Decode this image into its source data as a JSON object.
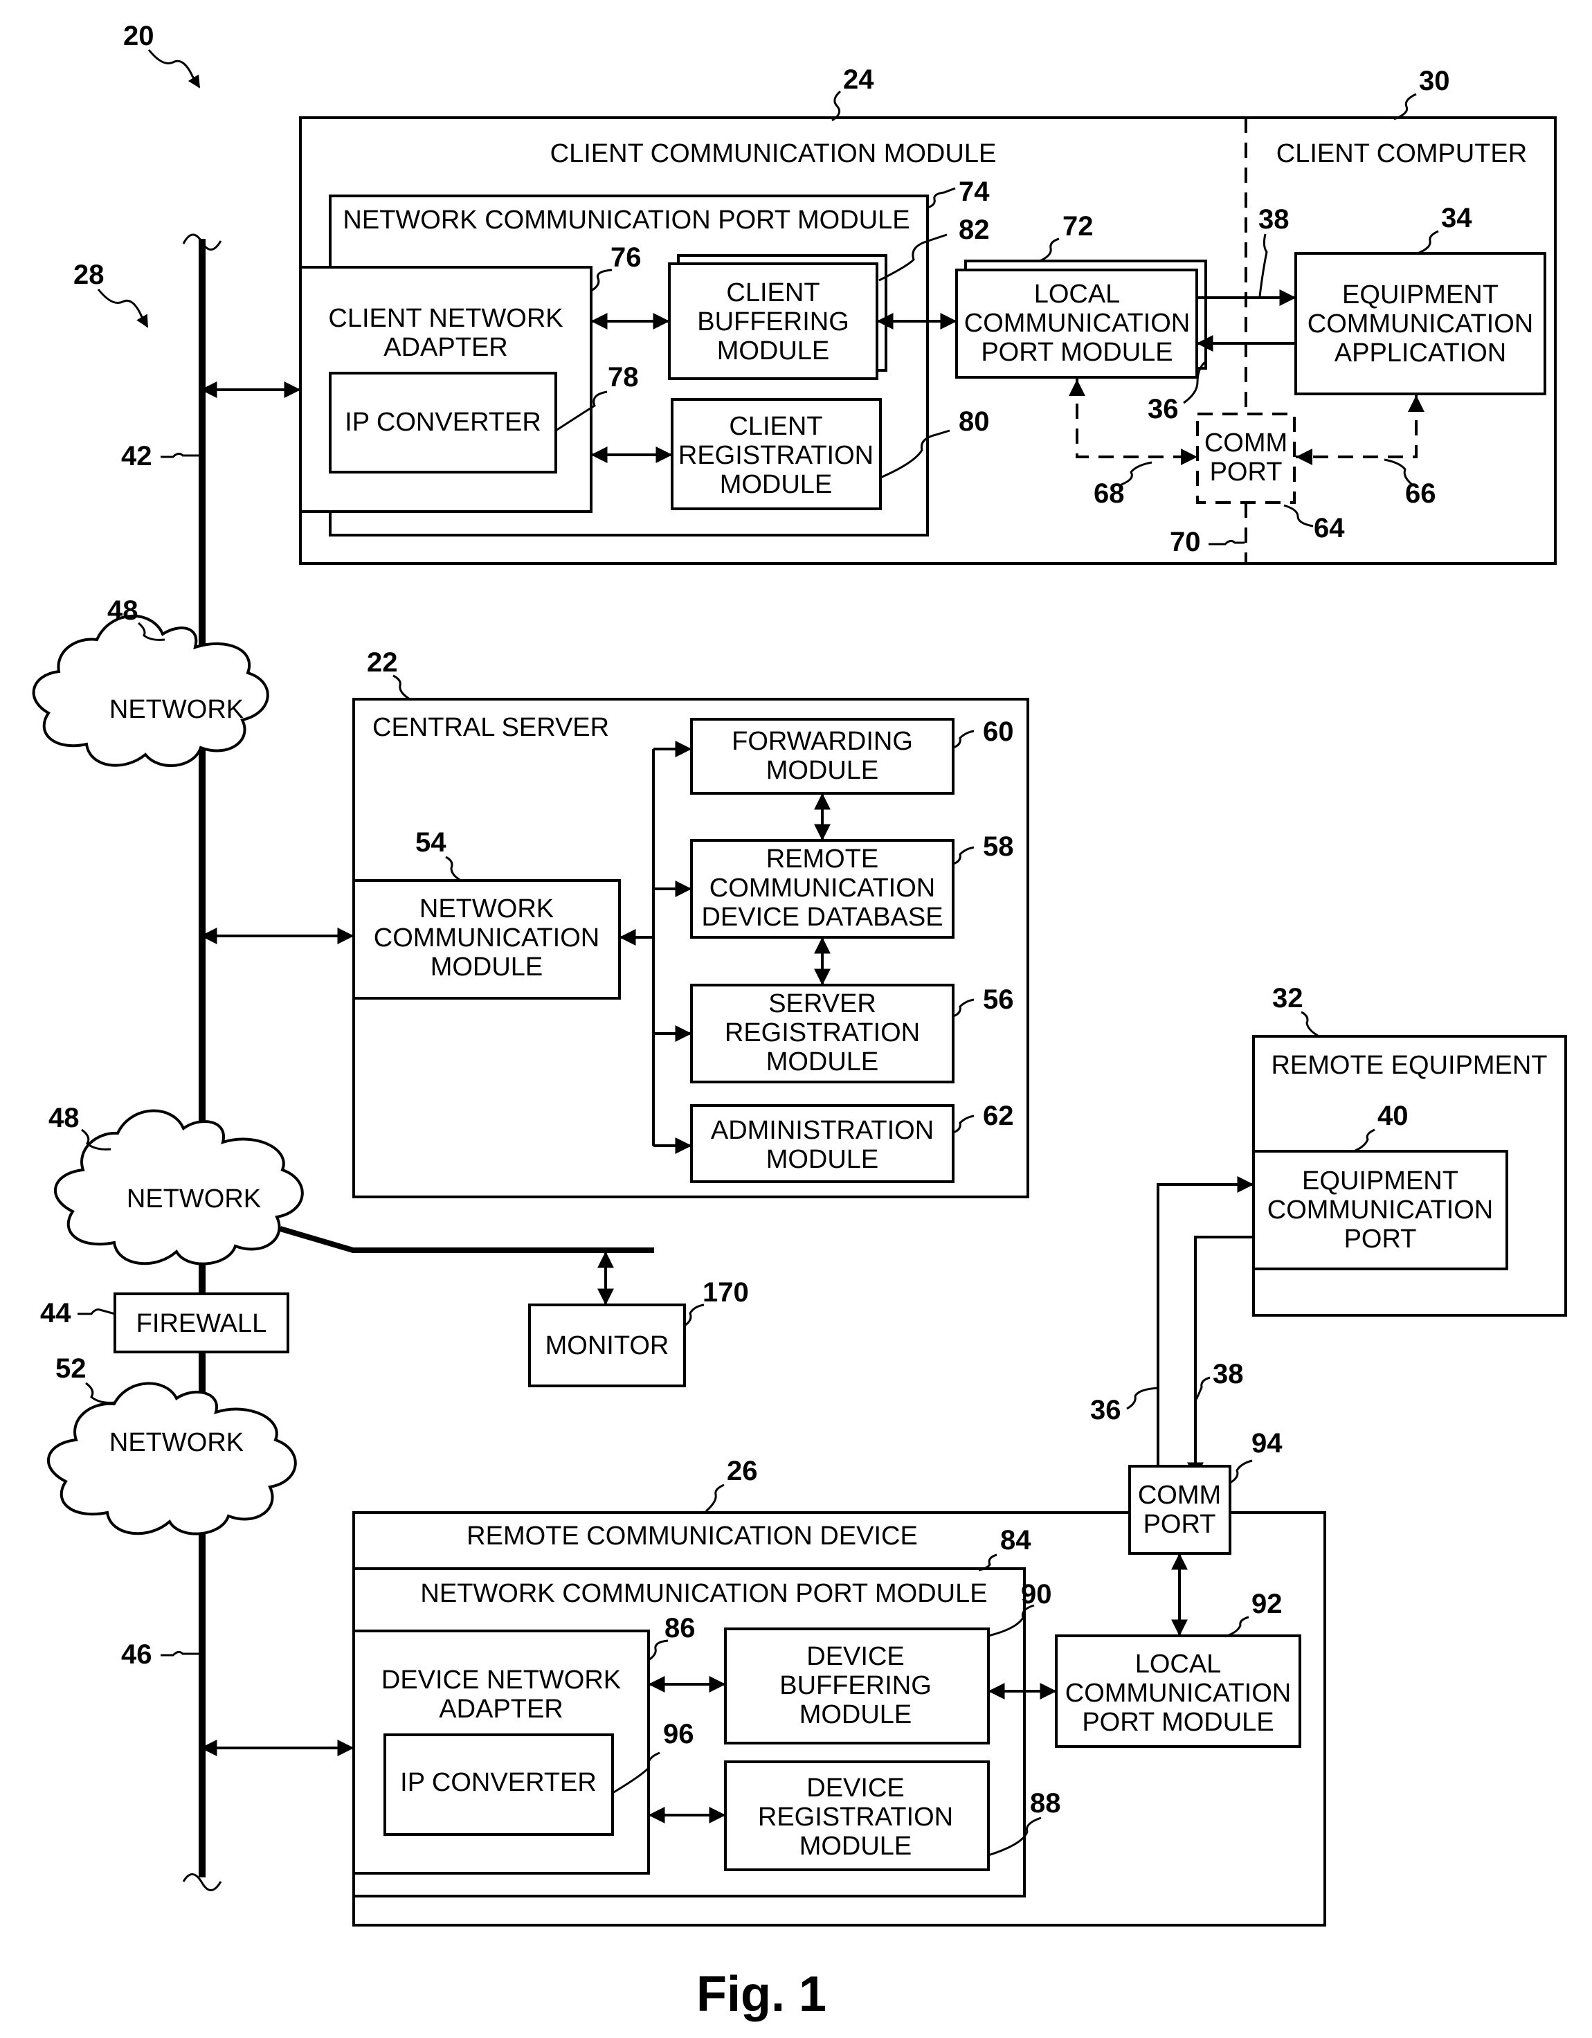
{
  "figure": {
    "caption": "Fig. 1",
    "system_ref": "20",
    "network_system_ref": "28"
  },
  "client_comm_module": {
    "ref": "24",
    "title": "CLIENT COMMUNICATION MODULE",
    "ncpm": {
      "ref": "74",
      "title": "NETWORK COMMUNICATION PORT MODULE"
    },
    "network_adapter": {
      "ref": "76",
      "lines": [
        "CLIENT NETWORK",
        "ADAPTER"
      ]
    },
    "ip_converter": {
      "ref": "78",
      "label": "IP CONVERTER"
    },
    "buffering": {
      "ref": "82",
      "lines": [
        "CLIENT",
        "BUFFERING",
        "MODULE"
      ]
    },
    "registration": {
      "ref": "80",
      "lines": [
        "CLIENT",
        "REGISTRATION",
        "MODULE"
      ]
    },
    "local_port": {
      "ref": "72",
      "lines": [
        "LOCAL",
        "COMMUNICATION",
        "PORT MODULE"
      ]
    }
  },
  "client_computer": {
    "ref": "30",
    "title": "CLIENT COMPUTER",
    "app": {
      "ref": "34",
      "lines": [
        "EQUIPMENT",
        "COMMUNICATION",
        "APPLICATION"
      ]
    },
    "comm_port": {
      "ref": "64",
      "lines": [
        "COMM",
        "PORT"
      ]
    },
    "boundary_ref": "70",
    "dashed_link_left_ref": "68",
    "dashed_link_right_ref": "66",
    "tx_ref": "38",
    "rx_ref": "36"
  },
  "bus": {
    "upper_ref": "42",
    "lower_ref": "46"
  },
  "networks": [
    {
      "ref": "48",
      "label": "NETWORK"
    },
    {
      "ref": "48",
      "label": "NETWORK"
    },
    {
      "ref": "52",
      "label": "NETWORK"
    }
  ],
  "firewall": {
    "ref": "44",
    "label": "FIREWALL"
  },
  "monitor": {
    "ref": "170",
    "label": "MONITOR"
  },
  "central_server": {
    "ref": "22",
    "title": "CENTRAL SERVER",
    "ncm": {
      "ref": "54",
      "lines": [
        "NETWORK",
        "COMMUNICATION",
        "MODULE"
      ]
    },
    "forwarding": {
      "ref": "60",
      "lines": [
        "FORWARDING",
        "MODULE"
      ]
    },
    "database": {
      "ref": "58",
      "lines": [
        "REMOTE",
        "COMMUNICATION",
        "DEVICE DATABASE"
      ]
    },
    "registration": {
      "ref": "56",
      "lines": [
        "SERVER",
        "REGISTRATION",
        "MODULE"
      ]
    },
    "administration": {
      "ref": "62",
      "lines": [
        "ADMINISTRATION",
        "MODULE"
      ]
    }
  },
  "remote_equipment": {
    "ref": "32",
    "title": "REMOTE EQUIPMENT",
    "port": {
      "ref": "40",
      "lines": [
        "EQUIPMENT",
        "COMMUNICATION",
        "PORT"
      ]
    },
    "rx_ref": "36",
    "tx_ref": "38"
  },
  "remote_device": {
    "ref": "26",
    "title": "REMOTE COMMUNICATION DEVICE",
    "ncpm": {
      "ref": "84",
      "title": "NETWORK COMMUNICATION PORT MODULE"
    },
    "network_adapter": {
      "ref": "86",
      "lines": [
        "DEVICE NETWORK",
        "ADAPTER"
      ]
    },
    "ip_converter": {
      "ref": "96",
      "label": "IP CONVERTER"
    },
    "buffering": {
      "ref": "90",
      "lines": [
        "DEVICE",
        "BUFFERING",
        "MODULE"
      ]
    },
    "registration": {
      "ref": "88",
      "lines": [
        "DEVICE",
        "REGISTRATION",
        "MODULE"
      ]
    },
    "local_port": {
      "ref": "92",
      "lines": [
        "LOCAL",
        "COMMUNICATION",
        "PORT MODULE"
      ]
    },
    "comm_port": {
      "ref": "94",
      "lines": [
        "COMM",
        "PORT"
      ]
    }
  }
}
